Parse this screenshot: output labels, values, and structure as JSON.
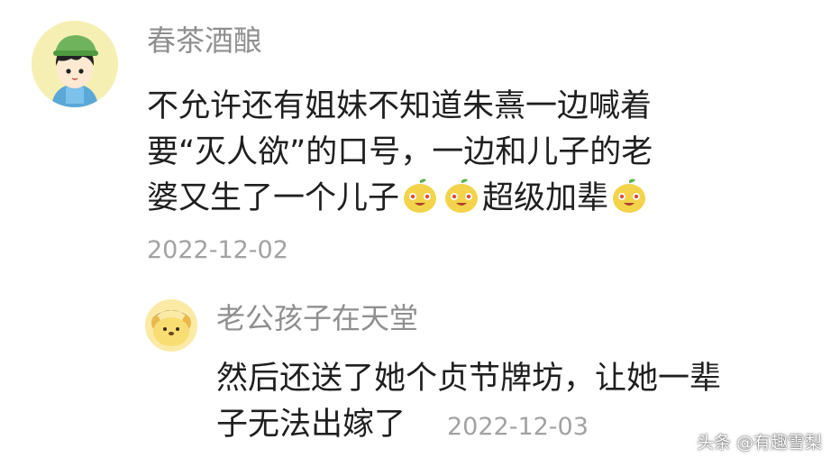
{
  "comment": {
    "username": "春茶酒酿",
    "lines": [
      "不允许还有姐妹不知道朱熹一边喊着",
      "要“灭人欲”的口号，一边和儿子的老",
      "婆又生了一个儿子"
    ],
    "line3_suffix": "超级加辈",
    "emoji_icon": "smiling-pear-emoji",
    "timestamp": "2022-12-02"
  },
  "reply": {
    "username": "老公孩子在天堂",
    "lines": [
      "然后还送了她个贞节牌坊，让她一辈",
      "子无法出嫁了"
    ],
    "timestamp": "2022-12-03"
  },
  "watermark": "头条 @有趣雪梨",
  "colors": {
    "username": "#8f8f8f",
    "text": "#1f1f1f",
    "timestamp": "#a2a2a2",
    "emoji": "#f3d34a"
  }
}
